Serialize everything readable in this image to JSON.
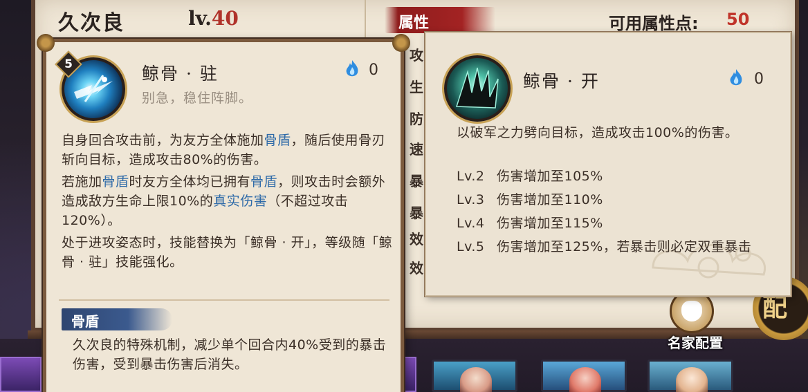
{
  "character": {
    "name": "久次良",
    "level_prefix": "lv.",
    "level_value": "40"
  },
  "attributes": {
    "tab_label": "属性",
    "points_label": "可用属性点:",
    "points_value": "50",
    "row_labels": [
      "攻",
      "生",
      "防",
      "速",
      "暴",
      "暴",
      "效",
      "效"
    ]
  },
  "skill_left": {
    "level_badge": "5",
    "name": "鲸骨 · 驻",
    "subtitle": "别急，稳住阵脚。",
    "cost": "0",
    "desc1_a": "自身回合攻击前，为友方全体施加",
    "desc1_kw": "骨盾",
    "desc1_b": "，随后使用骨刃斩向目标，造成攻击80%的伤害。",
    "desc2_a": "若施加",
    "desc2_kw1": "骨盾",
    "desc2_b": "时友方全体均已拥有",
    "desc2_kw2": "骨盾",
    "desc2_c": "，则攻击时会额外造成敌方生命上限10%的",
    "desc2_kw3": "真实伤害",
    "desc2_d": "（不超过攻击120%）。",
    "desc3": "处于进攻姿态时，技能替换为「鲸骨 · 开」，等级随「鲸骨 · 驻」技能强化。",
    "tag_label": "骨盾",
    "tag_desc": "久次良的特殊机制，减少单个回合内40%受到的暴击伤害，受到暴击伤害后消失。"
  },
  "skill_right": {
    "name": "鲸骨 · 开",
    "cost": "0",
    "desc": "以破军之力劈向目标，造成攻击100%的伤害。",
    "levels": [
      {
        "lv": "Lv.2",
        "text": "伤害增加至105%"
      },
      {
        "lv": "Lv.3",
        "text": "伤害增加至110%"
      },
      {
        "lv": "Lv.4",
        "text": "伤害增加至115%"
      },
      {
        "lv": "Lv.5",
        "text": "伤害增加至125%，若暴击则必定双重暴击"
      }
    ]
  },
  "bottom": {
    "mingjia_label": "名家配置",
    "peizhi_glyph": "配"
  },
  "colors": {
    "keyword": "#2e6aa8",
    "level_red": "#b0322a",
    "attr_tab_red": "#a32323",
    "parchment": "#efe6d6"
  }
}
